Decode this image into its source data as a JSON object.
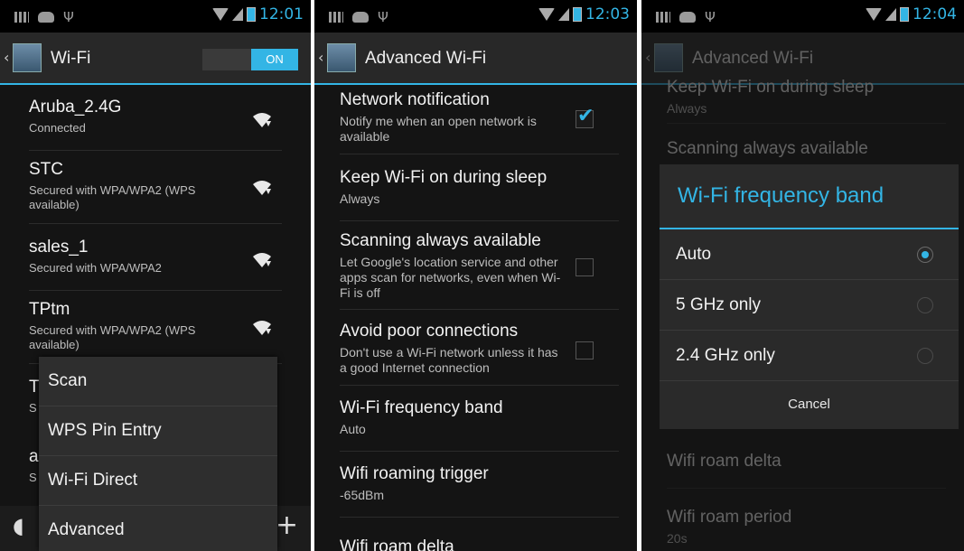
{
  "status_bar": {
    "p1_time": "12:01",
    "p2_time": "12:03",
    "p3_time": "12:04"
  },
  "panel1": {
    "title": "Wi-Fi",
    "toggle_label": "ON",
    "networks": [
      {
        "name": "Aruba_2.4G",
        "status": "Connected"
      },
      {
        "name": "STC",
        "status": "Secured with WPA/WPA2 (WPS available)"
      },
      {
        "name": "sales_1",
        "status": "Secured with WPA/WPA2"
      },
      {
        "name": "TPtm",
        "status": "Secured with WPA/WPA2 (WPS available)"
      },
      {
        "name": "T",
        "status": "S"
      },
      {
        "name": "a",
        "status": "S"
      }
    ],
    "menu": [
      "Scan",
      "WPS Pin Entry",
      "Wi-Fi Direct",
      "Advanced"
    ]
  },
  "panel2": {
    "title": "Advanced Wi-Fi",
    "prefs": [
      {
        "title": "Network notification",
        "summary": "Notify me when an open network is available",
        "checked": true
      },
      {
        "title": "Keep Wi-Fi on during sleep",
        "summary": "Always"
      },
      {
        "title": "Scanning always available",
        "summary": "Let Google's location service and other apps scan for networks, even when Wi-Fi is off",
        "checked": false
      },
      {
        "title": "Avoid poor connections",
        "summary": "Don't use a Wi-Fi network unless it has a good Internet connection",
        "checked": false
      },
      {
        "title": "Wi-Fi frequency band",
        "summary": "Auto"
      },
      {
        "title": "Wifi roaming trigger",
        "summary": "-65dBm"
      },
      {
        "title": "Wifi roam delta",
        "summary": ""
      }
    ]
  },
  "panel3": {
    "title": "Advanced Wi-Fi",
    "bg_prefs": [
      {
        "title": "Keep Wi-Fi on during sleep",
        "summary": "Always"
      },
      {
        "title": "Scanning always available",
        "summary": ""
      },
      {
        "title": "Wifi roam delta",
        "summary": ""
      },
      {
        "title": "Wifi roam period",
        "summary": "20s"
      }
    ],
    "dialog": {
      "title": "Wi-Fi frequency band",
      "options": [
        "Auto",
        "5 GHz only",
        "2.4 GHz only"
      ],
      "selected": "Auto",
      "cancel": "Cancel"
    }
  },
  "colors": {
    "accent": "#33b5e5",
    "background": "#141414"
  }
}
